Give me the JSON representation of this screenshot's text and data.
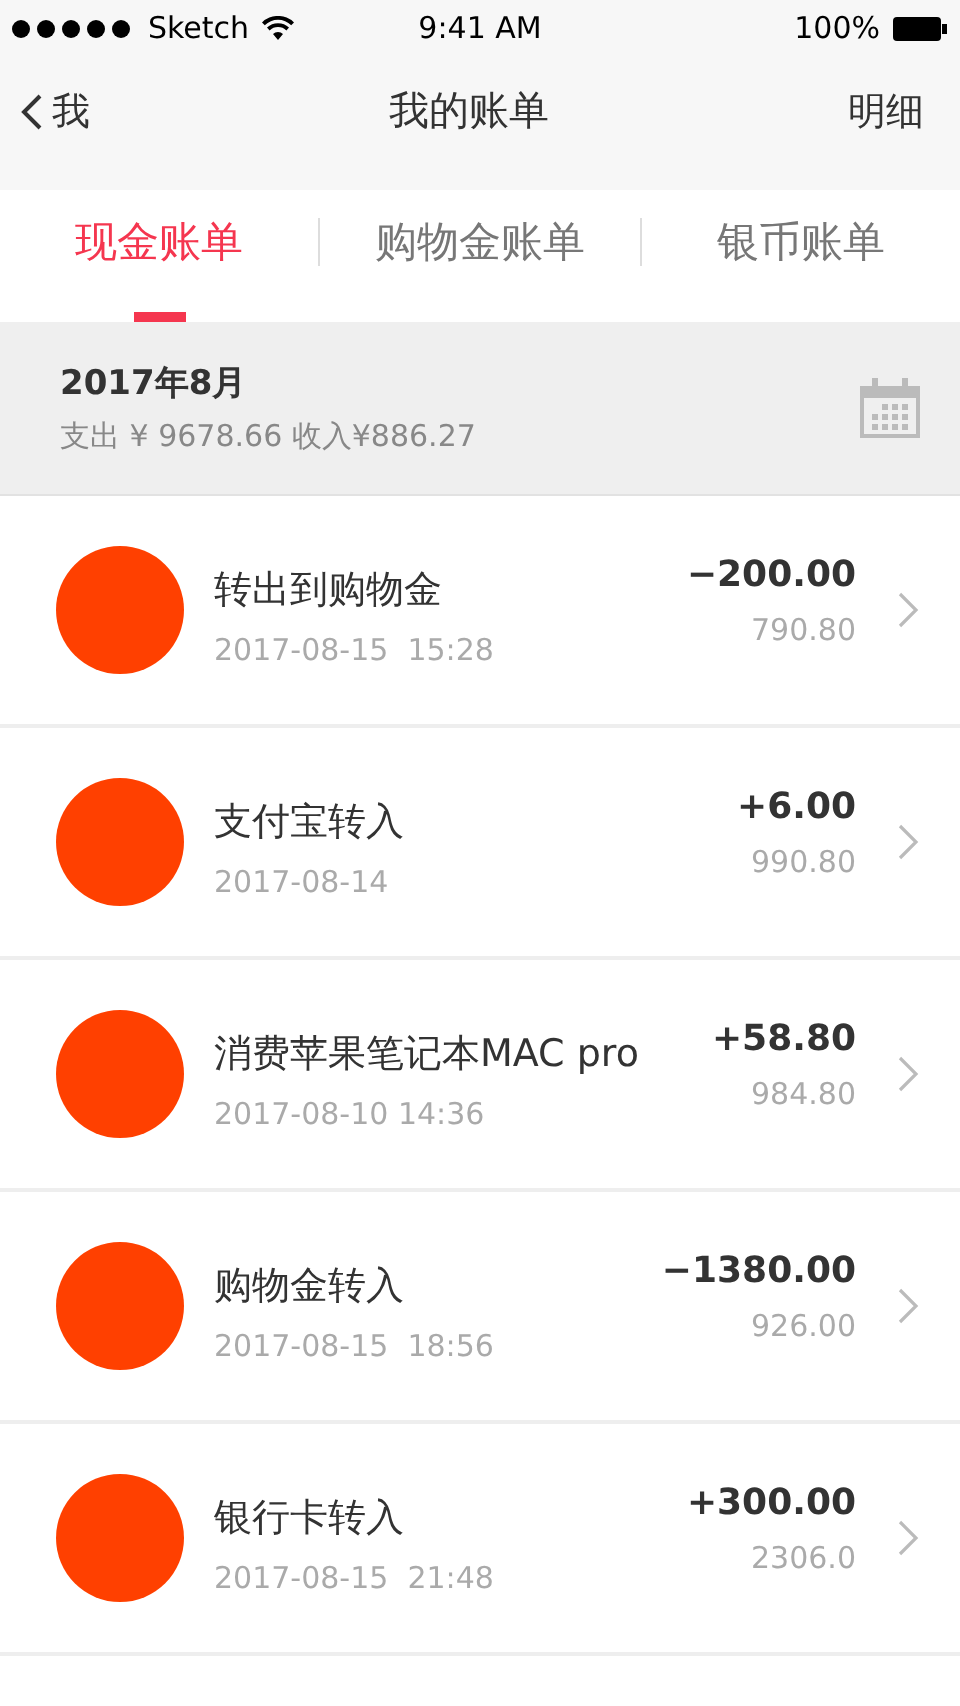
{
  "status_bar": {
    "carrier": "Sketch",
    "time": "9:41 AM",
    "battery": "100%"
  },
  "nav": {
    "back": "我",
    "title": "我的账单",
    "action": "明细"
  },
  "tabs": [
    {
      "label": "现金账单",
      "selected": true
    },
    {
      "label": "购物金账单",
      "selected": false
    },
    {
      "label": "银币账单",
      "selected": false
    }
  ],
  "summary": {
    "month": "2017年8月",
    "totals": "支出 ¥ 9678.66 收入¥886.27"
  },
  "transactions": [
    {
      "title": "转出到购物金",
      "time": "2017-08-15  15:28",
      "amount": "−200.00",
      "balance": "790.80",
      "color": "#ff4000"
    },
    {
      "title": "支付宝转入",
      "time": "2017-08-14",
      "amount": "+6.00",
      "balance": "990.80",
      "color": "#ff4000"
    },
    {
      "title": "消费苹果笔记本MAC pro",
      "time": "2017-08-10 14:36",
      "amount": "+58.80",
      "balance": "984.80",
      "color": "#ff4000"
    },
    {
      "title": "购物金转入",
      "time": "2017-08-15  18:56",
      "amount": "−1380.00",
      "balance": "926.00",
      "color": "#ff4000"
    },
    {
      "title": "银行卡转入",
      "time": "2017-08-15  21:48",
      "amount": "+300.00",
      "balance": "2306.0",
      "color": "#ff4000"
    }
  ]
}
